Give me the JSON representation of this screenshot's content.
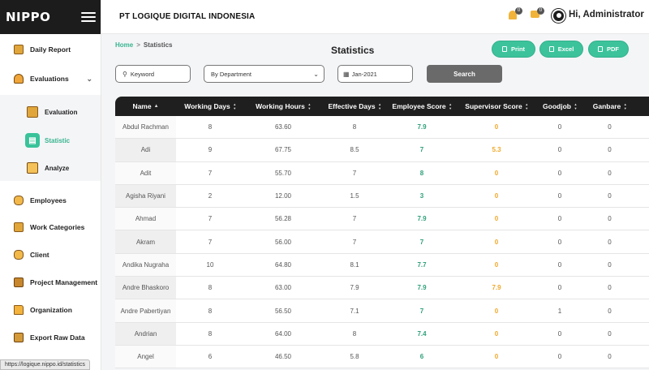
{
  "brand": {
    "logo": "NIPPO"
  },
  "header": {
    "company": "PT LOGIQUE DIGITAL INDONESIA",
    "notifications_count": "0",
    "messages_count": "0",
    "greeting": "Hi, Administrator"
  },
  "sidebar": {
    "items": [
      {
        "label": "Daily Report",
        "icon": "daily-report-icon"
      },
      {
        "label": "Evaluations",
        "icon": "evaluations-icon"
      },
      {
        "label": "Employees",
        "icon": "employees-icon"
      },
      {
        "label": "Work Categories",
        "icon": "work-categories-icon"
      },
      {
        "label": "Client",
        "icon": "client-icon"
      },
      {
        "label": "Project Management",
        "icon": "project-management-icon"
      },
      {
        "label": "Organization",
        "icon": "organization-icon"
      },
      {
        "label": "Export Raw Data",
        "icon": "export-icon"
      }
    ],
    "sub_items": [
      {
        "label": "Evaluation",
        "icon": "evaluation-icon"
      },
      {
        "label": "Statistic",
        "icon": "statistic-icon",
        "active": true
      },
      {
        "label": "Analyze",
        "icon": "analyze-icon"
      }
    ]
  },
  "breadcrumb": {
    "home": "Home",
    "separator": ">",
    "current": "Statistics"
  },
  "page": {
    "title": "Statistics"
  },
  "actions": {
    "print": "Print",
    "excel": "Excel",
    "pdf": "PDF"
  },
  "filters": {
    "keyword_placeholder": "Keyword",
    "department": "By Department",
    "month": "Jan-2021",
    "search_label": "Search"
  },
  "table": {
    "headers": [
      "Name",
      "Working Days",
      "Working Hours",
      "Effective Days",
      "Employee Score",
      "Supervisor Score",
      "Goodjob",
      "Ganbare"
    ],
    "rows": [
      [
        "Abdul Rachman",
        "8",
        "63.60",
        "8",
        "7.9",
        "0",
        "0",
        "0"
      ],
      [
        "Adi",
        "9",
        "67.75",
        "8.5",
        "7",
        "5.3",
        "0",
        "0"
      ],
      [
        "Adit",
        "7",
        "55.70",
        "7",
        "8",
        "0",
        "0",
        "0"
      ],
      [
        "Agisha Riyani",
        "2",
        "12.00",
        "1.5",
        "3",
        "0",
        "0",
        "0"
      ],
      [
        "Ahmad",
        "7",
        "56.28",
        "7",
        "7.9",
        "0",
        "0",
        "0"
      ],
      [
        "Akram",
        "7",
        "56.00",
        "7",
        "7",
        "0",
        "0",
        "0"
      ],
      [
        "Andika Nugraha",
        "10",
        "64.80",
        "8.1",
        "7.7",
        "0",
        "0",
        "0"
      ],
      [
        "Andre Bhaskoro",
        "8",
        "63.00",
        "7.9",
        "7.9",
        "7.9",
        "0",
        "0"
      ],
      [
        "Andre Pabertiyan",
        "8",
        "56.50",
        "7.1",
        "7",
        "0",
        "1",
        "0"
      ],
      [
        "Andrian",
        "8",
        "64.00",
        "8",
        "7.4",
        "0",
        "0",
        "0"
      ],
      [
        "Angel",
        "6",
        "46.50",
        "5.8",
        "6",
        "0",
        "0",
        "0"
      ]
    ]
  },
  "status_url": "https://logique.nippo.id/statistics",
  "colors": {
    "accent": "#3cc39c",
    "header_dark": "#1f1f1f",
    "score_green": "#2fa07a",
    "score_orange": "#f0a92a"
  }
}
